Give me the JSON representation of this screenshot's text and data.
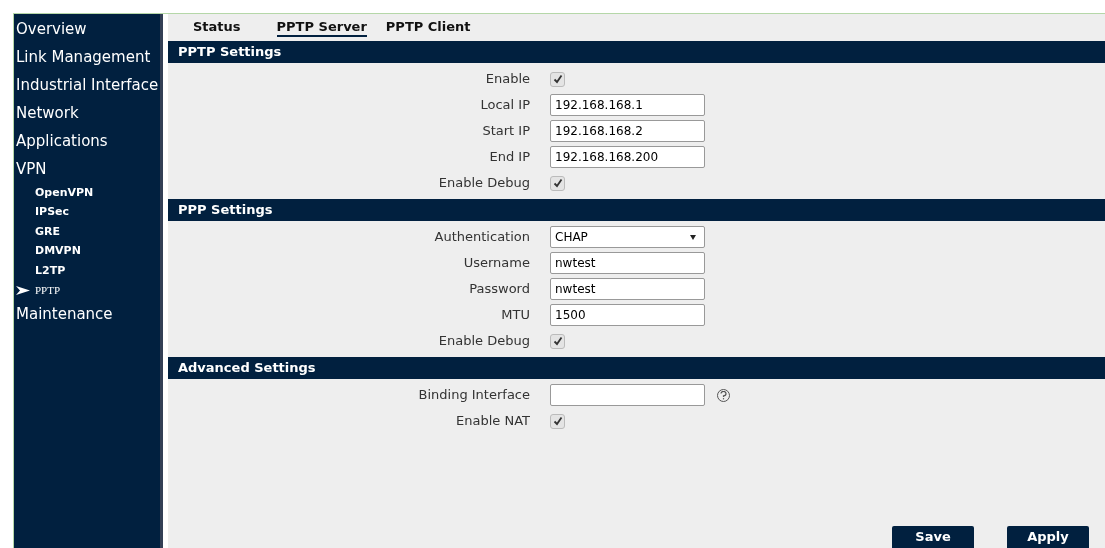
{
  "sidebar": {
    "items": [
      {
        "label": "Overview",
        "selected": false
      },
      {
        "label": "Link Management",
        "selected": false
      },
      {
        "label": "Industrial Interface",
        "selected": false
      },
      {
        "label": "Network",
        "selected": false
      },
      {
        "label": "Applications",
        "selected": false
      },
      {
        "label": "VPN",
        "selected": false,
        "children": [
          {
            "label": "OpenVPN",
            "selected": false
          },
          {
            "label": "IPSec",
            "selected": false
          },
          {
            "label": "GRE",
            "selected": false
          },
          {
            "label": "DMVPN",
            "selected": false
          },
          {
            "label": "L2TP",
            "selected": false
          },
          {
            "label": "PPTP",
            "selected": true
          }
        ]
      },
      {
        "label": "Maintenance",
        "selected": false
      }
    ]
  },
  "tabs": [
    {
      "label": "Status",
      "selected": false
    },
    {
      "label": "PPTP Server",
      "selected": true
    },
    {
      "label": "PPTP Client",
      "selected": false
    }
  ],
  "sections": [
    {
      "title": "PPTP Settings",
      "fields": [
        {
          "kind": "checkbox",
          "label": "Enable",
          "checked": true
        },
        {
          "kind": "text",
          "label": "Local IP",
          "value": "192.168.168.1"
        },
        {
          "kind": "text",
          "label": "Start IP",
          "value": "192.168.168.2"
        },
        {
          "kind": "text",
          "label": "End IP",
          "value": "192.168.168.200"
        },
        {
          "kind": "checkbox",
          "label": "Enable Debug",
          "checked": true
        }
      ]
    },
    {
      "title": "PPP Settings",
      "fields": [
        {
          "kind": "select",
          "label": "Authentication",
          "value": "CHAP"
        },
        {
          "kind": "text",
          "label": "Username",
          "value": "nwtest"
        },
        {
          "kind": "text",
          "label": "Password",
          "value": "nwtest"
        },
        {
          "kind": "text",
          "label": "MTU",
          "value": "1500"
        },
        {
          "kind": "checkbox",
          "label": "Enable Debug",
          "checked": true
        }
      ]
    },
    {
      "title": "Advanced Settings",
      "fields": [
        {
          "kind": "text",
          "label": "Binding Interface",
          "help": true
        },
        {
          "kind": "checkbox",
          "label": "Enable NAT",
          "checked": true
        }
      ]
    }
  ],
  "buttons": [
    "Save",
    "Apply"
  ]
}
